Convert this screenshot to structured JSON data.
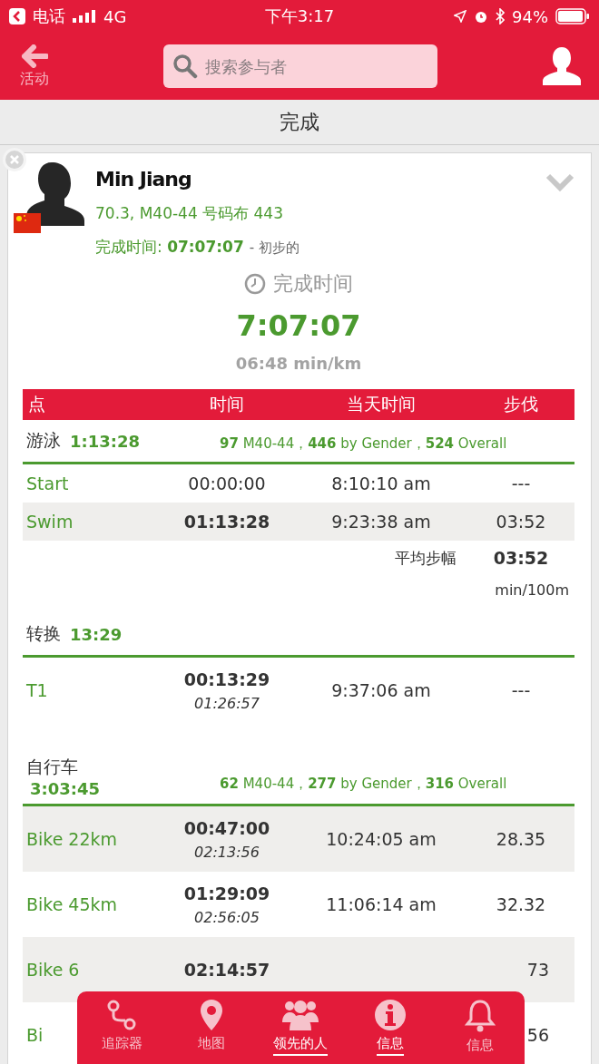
{
  "status_bar": {
    "back_app": "电话",
    "network": "4G",
    "time": "下午3:17",
    "battery": "94%"
  },
  "header": {
    "back_label": "活动",
    "search": {
      "placeholder": "搜索参与者"
    }
  },
  "title": "完成",
  "athlete": {
    "name": "Min Jiang",
    "details": "70.3, M40-44 号码布 443",
    "finish_line": "完成时间: **07:07:07**",
    "finish_status": "- 初步的",
    "expanded": false
  },
  "summary": {
    "label": "完成时间",
    "time": "7:07:07",
    "pace": "06:48 min/km"
  },
  "table": {
    "columns": [
      "点",
      "时间",
      "当天时间",
      "步伐"
    ],
    "sections": [
      {
        "title": "游泳",
        "total": "1:13:28",
        "kind": "inline",
        "ranks": "**97** M40-44，**446** by Gender，**524** Overall",
        "rows": [
          {
            "point": "Start",
            "time": "00:00:00",
            "bold": false,
            "time_of_day": "8:10:10 am",
            "pace": "---",
            "shaded": false
          },
          {
            "point": "Swim",
            "time": "01:13:28",
            "bold": true,
            "time_of_day": "9:23:38 am",
            "pace": "03:52",
            "shaded": true
          }
        ],
        "average": {
          "label": "平均步幅",
          "value": "03:52",
          "unit": "min/100m"
        }
      },
      {
        "title": "转换",
        "total": "13:29",
        "kind": "inline",
        "rows": [
          {
            "point": "T1",
            "time": "00:13:29",
            "cumulative": "01:26:57",
            "bold": true,
            "time_of_day": "9:37:06 am",
            "pace": "---",
            "shaded": false
          }
        ]
      },
      {
        "title": "自行车",
        "total": "3:03:45",
        "kind": "stacked",
        "ranks": "**62** M40-44，**277** by Gender，**316** Overall",
        "rows": [
          {
            "point": "Bike 22km",
            "time": "00:47:00",
            "cumulative": "02:13:56",
            "bold": true,
            "time_of_day": "10:24:05 am",
            "pace": "28.35",
            "shaded": true
          },
          {
            "point": "Bike 45km",
            "time": "01:29:09",
            "cumulative": "02:56:05",
            "bold": true,
            "time_of_day": "11:06:14 am",
            "pace": "32.32",
            "shaded": false
          },
          {
            "point": "Bike 6",
            "time": "02:14:57",
            "bold": true,
            "pace": "73",
            "shaded": true
          },
          {
            "point": "Bi",
            "pace": "56",
            "shaded": false
          }
        ]
      }
    ]
  },
  "tab_bar": [
    {
      "label": "追踪器",
      "kind": "tracker",
      "selected": false
    },
    {
      "label": "地图",
      "kind": "map",
      "selected": false
    },
    {
      "label": "领先的人",
      "kind": "leaders",
      "selected": true
    },
    {
      "label": "信息",
      "kind": "info",
      "selected": true
    },
    {
      "label": "信息",
      "kind": "alerts",
      "selected": false
    }
  ]
}
